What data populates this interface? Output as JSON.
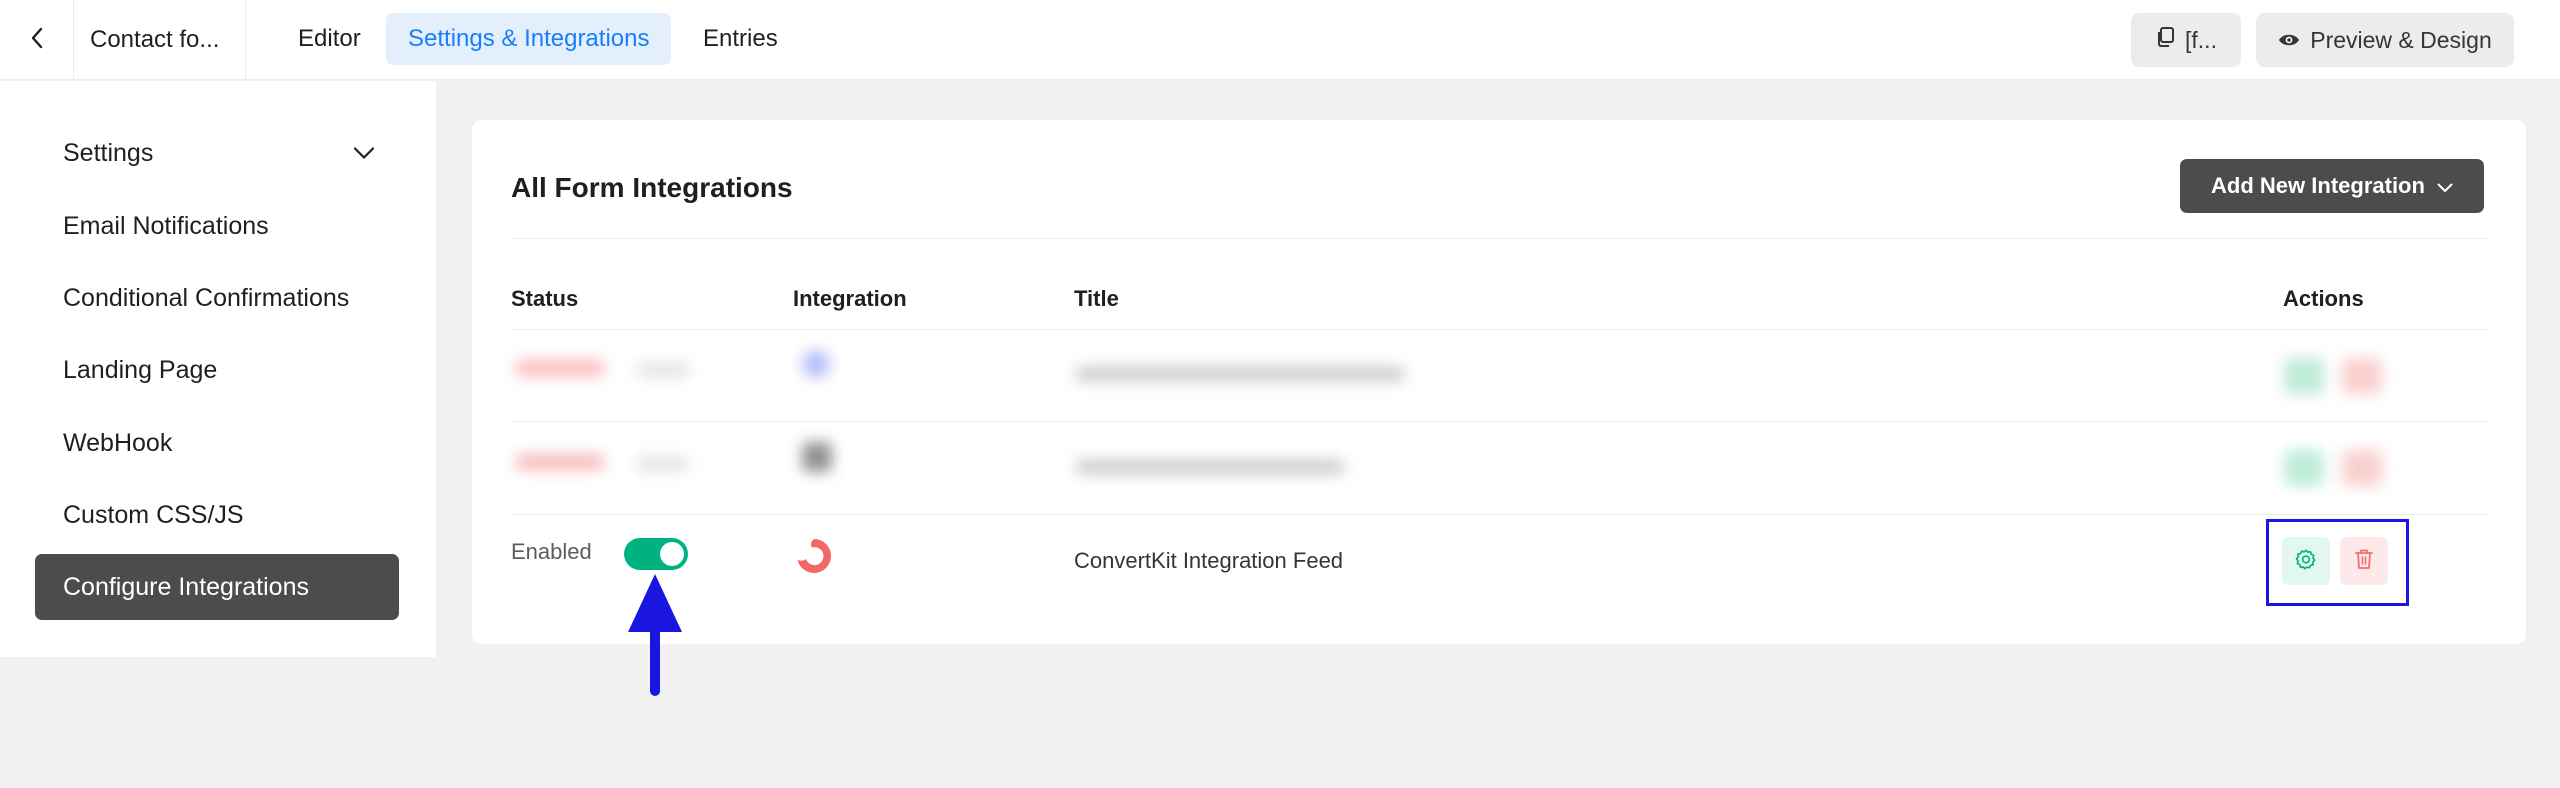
{
  "topbar": {
    "form_title": "Contact fo...",
    "tabs": [
      {
        "label": "Editor"
      },
      {
        "label": "Settings & Integrations"
      },
      {
        "label": "Entries"
      }
    ],
    "shortcode_label": "[f...",
    "preview_label": "Preview & Design"
  },
  "sidebar": {
    "items": [
      {
        "label": "Settings"
      },
      {
        "label": "Email Notifications"
      },
      {
        "label": "Conditional Confirmations"
      },
      {
        "label": "Landing Page"
      },
      {
        "label": "WebHook"
      },
      {
        "label": "Custom CSS/JS"
      },
      {
        "label": "Configure Integrations"
      }
    ]
  },
  "main": {
    "title": "All Form Integrations",
    "add_button_label": "Add New Integration",
    "columns": [
      "Status",
      "Integration",
      "Title",
      "Actions"
    ],
    "rows": [
      {
        "status": "Enabled",
        "enabled": true,
        "title": "ConvertKit Integration Feed"
      }
    ]
  },
  "colors": {
    "accent": "#1a7efb",
    "toggle_on": "#00b27f",
    "convertkit_logo": "#f26767",
    "highlight": "#1a16e0"
  }
}
